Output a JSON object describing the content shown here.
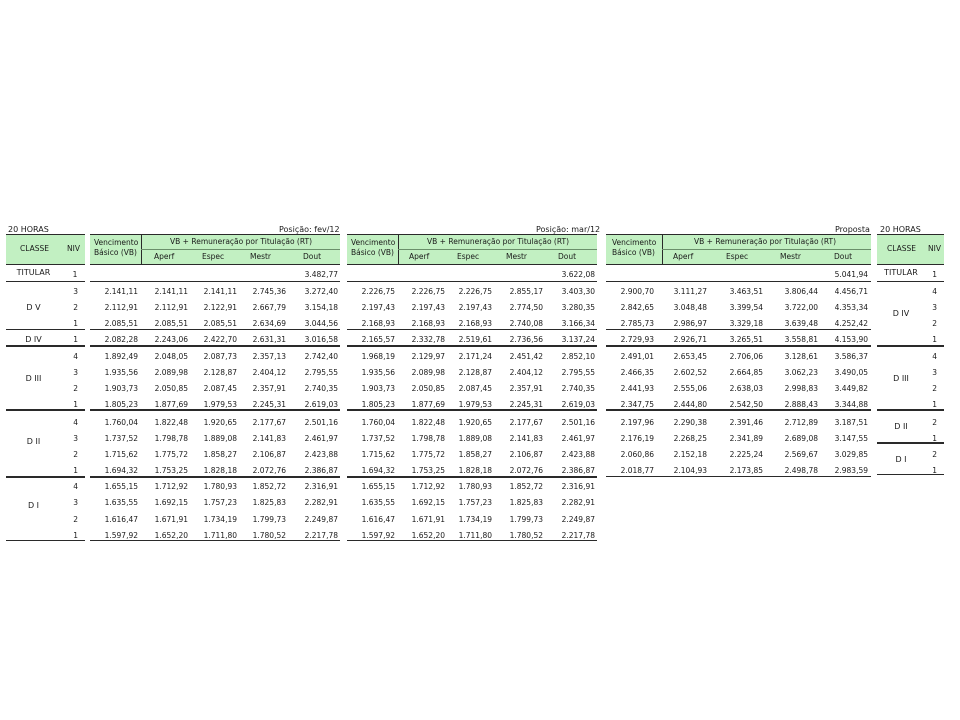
{
  "header": {
    "left_title": "20 HORAS",
    "pos_fev": "Posição: fev/12",
    "pos_mar": "Posição: mar/12",
    "proposta": "Proposta",
    "right_title": "20 HORAS"
  },
  "columns": {
    "classe": "CLASSE",
    "niv": "NIV",
    "venc1": "Vencimento",
    "venc2": "Básico (VB)",
    "rt": "VB + Remuneração por Titulação (RT)",
    "aperf": "Aperf",
    "espec": "Espec",
    "mestr": "Mestr",
    "dout": "Dout"
  },
  "left_rows": [
    {
      "classe": "TITULAR",
      "niv": "1"
    },
    {
      "classe": "D V",
      "niv": "3"
    },
    {
      "classe": "",
      "niv": "2"
    },
    {
      "classe": "",
      "niv": "1"
    },
    {
      "classe": "D IV",
      "niv": "1"
    },
    {
      "classe": "D III",
      "niv": "4"
    },
    {
      "classe": "",
      "niv": "3"
    },
    {
      "classe": "",
      "niv": "2"
    },
    {
      "classe": "",
      "niv": "1"
    },
    {
      "classe": "D II",
      "niv": "4"
    },
    {
      "classe": "",
      "niv": "3"
    },
    {
      "classe": "",
      "niv": "2"
    },
    {
      "classe": "",
      "niv": "1"
    },
    {
      "classe": "D I",
      "niv": "4"
    },
    {
      "classe": "",
      "niv": "3"
    },
    {
      "classe": "",
      "niv": "2"
    },
    {
      "classe": "",
      "niv": "1"
    }
  ],
  "fev": [
    [
      "",
      "",
      "",
      "",
      "3.482,77"
    ],
    [
      "2.141,11",
      "2.141,11",
      "2.141,11",
      "2.745,36",
      "3.272,40"
    ],
    [
      "2.112,91",
      "2.112,91",
      "2.122,91",
      "2.667,79",
      "3.154,18"
    ],
    [
      "2.085,51",
      "2.085,51",
      "2.085,51",
      "2.634,69",
      "3.044,56"
    ],
    [
      "2.082,28",
      "2.243,06",
      "2.422,70",
      "2.631,31",
      "3.016,58"
    ],
    [
      "1.892,49",
      "2.048,05",
      "2.087,73",
      "2.357,13",
      "2.742,40"
    ],
    [
      "1.935,56",
      "2.089,98",
      "2.128,87",
      "2.404,12",
      "2.795,55"
    ],
    [
      "1.903,73",
      "2.050,85",
      "2.087,45",
      "2.357,91",
      "2.740,35"
    ],
    [
      "1.805,23",
      "1.877,69",
      "1.979,53",
      "2.245,31",
      "2.619,03"
    ],
    [
      "1.760,04",
      "1.822,48",
      "1.920,65",
      "2.177,67",
      "2.501,16"
    ],
    [
      "1.737,52",
      "1.798,78",
      "1.889,08",
      "2.141,83",
      "2.461,97"
    ],
    [
      "1.715,62",
      "1.775,72",
      "1.858,27",
      "2.106,87",
      "2.423,88"
    ],
    [
      "1.694,32",
      "1.753,25",
      "1.828,18",
      "2.072,76",
      "2.386,87"
    ],
    [
      "1.655,15",
      "1.712,92",
      "1.780,93",
      "1.852,72",
      "2.316,91"
    ],
    [
      "1.635,55",
      "1.692,15",
      "1.757,23",
      "1.825,83",
      "2.282,91"
    ],
    [
      "1.616,47",
      "1.671,91",
      "1.734,19",
      "1.799,73",
      "2.249,87"
    ],
    [
      "1.597,92",
      "1.652,20",
      "1.711,80",
      "1.780,52",
      "2.217,78"
    ]
  ],
  "mar": [
    [
      "",
      "",
      "",
      "",
      "3.622,08"
    ],
    [
      "2.226,75",
      "2.226,75",
      "2.226,75",
      "2.855,17",
      "3.403,30"
    ],
    [
      "2.197,43",
      "2.197,43",
      "2.197,43",
      "2.774,50",
      "3.280,35"
    ],
    [
      "2.168,93",
      "2.168,93",
      "2.168,93",
      "2.740,08",
      "3.166,34"
    ],
    [
      "2.165,57",
      "2.332,78",
      "2.519,61",
      "2.736,56",
      "3.137,24"
    ],
    [
      "1.968,19",
      "2.129,97",
      "2.171,24",
      "2.451,42",
      "2.852,10"
    ],
    [
      "1.935,56",
      "2.089,98",
      "2.128,87",
      "2.404,12",
      "2.795,55"
    ],
    [
      "1.903,73",
      "2.050,85",
      "2.087,45",
      "2.357,91",
      "2.740,35"
    ],
    [
      "1.805,23",
      "1.877,69",
      "1.979,53",
      "2.245,31",
      "2.619,03"
    ],
    [
      "1.760,04",
      "1.822,48",
      "1.920,65",
      "2.177,67",
      "2.501,16"
    ],
    [
      "1.737,52",
      "1.798,78",
      "1.889,08",
      "2.141,83",
      "2.461,97"
    ],
    [
      "1.715,62",
      "1.775,72",
      "1.858,27",
      "2.106,87",
      "2.423,88"
    ],
    [
      "1.694,32",
      "1.753,25",
      "1.828,18",
      "2.072,76",
      "2.386,87"
    ],
    [
      "1.655,15",
      "1.712,92",
      "1.780,93",
      "1.852,72",
      "2.316,91"
    ],
    [
      "1.635,55",
      "1.692,15",
      "1.757,23",
      "1.825,83",
      "2.282,91"
    ],
    [
      "1.616,47",
      "1.671,91",
      "1.734,19",
      "1.799,73",
      "2.249,87"
    ],
    [
      "1.597,92",
      "1.652,20",
      "1.711,80",
      "1.780,52",
      "2.217,78"
    ]
  ],
  "proposta": [
    [
      "",
      "",
      "",
      "",
      "5.041,94"
    ],
    [
      "2.900,70",
      "3.111,27",
      "3.463,51",
      "3.806,44",
      "4.456,71"
    ],
    [
      "2.842,65",
      "3.048,48",
      "3.399,54",
      "3.722,00",
      "4.353,34"
    ],
    [
      "2.785,73",
      "2.986,97",
      "3.329,18",
      "3.639,48",
      "4.252,42"
    ],
    [
      "2.729,93",
      "2.926,71",
      "3.265,51",
      "3.558,81",
      "4.153,90"
    ],
    [
      "2.491,01",
      "2.653,45",
      "2.706,06",
      "3.128,61",
      "3.586,37"
    ],
    [
      "2.466,35",
      "2.602,52",
      "2.664,85",
      "3.062,23",
      "3.490,05"
    ],
    [
      "2.441,93",
      "2.555,06",
      "2.638,03",
      "2.998,83",
      "3.449,82"
    ],
    [
      "2.347,75",
      "2.444,80",
      "2.542,50",
      "2.888,43",
      "3.344,88"
    ],
    [
      "2.197,96",
      "2.290,38",
      "2.391,46",
      "2.712,89",
      "3.187,51"
    ],
    [
      "2.176,19",
      "2.268,25",
      "2.341,89",
      "2.689,08",
      "3.147,55"
    ],
    [
      "2.060,86",
      "2.152,18",
      "2.225,24",
      "2.569,67",
      "3.029,85"
    ],
    [
      "2.018,77",
      "2.104,93",
      "2.173,85",
      "2.498,78",
      "2.983,59"
    ]
  ],
  "right_classes": [
    {
      "classe": "TITULAR"
    },
    {
      "classe": "D IV"
    },
    {
      "classe": "D III"
    },
    {
      "classe": "D II"
    },
    {
      "classe": "D I"
    }
  ],
  "right_niv": [
    "1",
    "4",
    "3",
    "2",
    "1",
    "4",
    "3",
    "2",
    "1",
    "2",
    "1",
    "2",
    "1"
  ]
}
